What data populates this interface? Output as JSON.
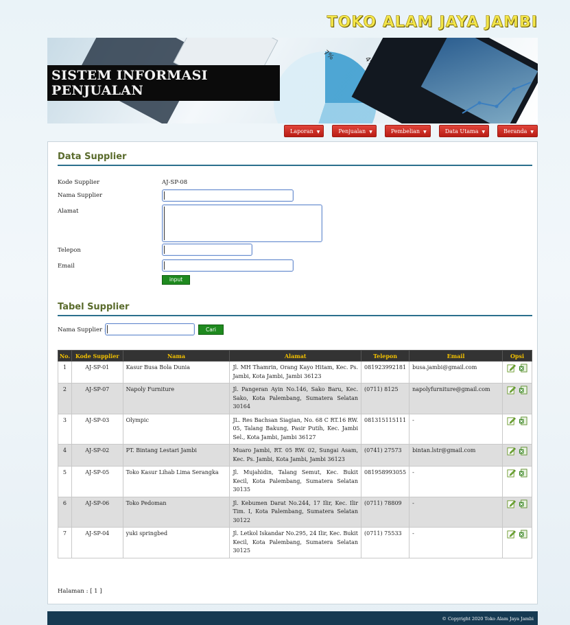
{
  "brand": "TOKO ALAM JAYA JAMBI",
  "banner": {
    "title": "SISTEM INFORMASI PENJUALAN",
    "pct1": "7%",
    "pct2": "4%"
  },
  "nav": [
    {
      "label": "Laporan"
    },
    {
      "label": "Penjualan"
    },
    {
      "label": "Pembelian"
    },
    {
      "label": "Data Utama"
    },
    {
      "label": "Beranda"
    }
  ],
  "form": {
    "title": "Data Supplier",
    "kode_label": "Kode Supplier",
    "kode_value": "AJ-SP-08",
    "nama_label": "Nama Supplier",
    "nama_value": "",
    "alamat_label": "Alamat",
    "alamat_value": "",
    "telepon_label": "Telepon",
    "telepon_value": "",
    "email_label": "Email",
    "email_value": "",
    "submit_label": "input"
  },
  "table_section": {
    "title": "Tabel Supplier",
    "search_label": "Nama Supplier :",
    "search_value": "",
    "search_button": "Cari"
  },
  "table": {
    "headers": [
      "No.",
      "Kode Supplier",
      "Nama",
      "Alamat",
      "Telepon",
      "Email",
      "Opsi"
    ],
    "rows": [
      {
        "no": "1",
        "kode": "AJ-SP-01",
        "nama": "Kasur Busa Bola Dunia",
        "alamat": "Jl. MH Thamrin, Orang Kayo Hitam, Kec. Ps. Jambi, Kota Jambi, Jambi 36123",
        "telepon": "081923992181",
        "email": "busa.jambi@gmail.com"
      },
      {
        "no": "2",
        "kode": "AJ-SP-07",
        "nama": "Napoly Furniture",
        "alamat": "Jl. Pangeran Ayin No.146, Sako Baru, Kec. Sako, Kota Palembang, Sumatera Selatan 30164",
        "telepon": "(0711) 8125",
        "email": "napolyfurniture@gmail.com"
      },
      {
        "no": "3",
        "kode": "AJ-SP-03",
        "nama": "Olympic",
        "alamat": "JL. Res Bachsan Siagian, No. 68 C RT.16 RW. 05, Talang Bakung, Pasir Putih, Kec. Jambi Sel., Kota Jambi, Jambi 36127",
        "telepon": "081315115111",
        "email": "-"
      },
      {
        "no": "4",
        "kode": "AJ-SP-02",
        "nama": "PT. Bintang Lestari Jambi",
        "alamat": "Muaro Jambi, RT. 05 RW. 02, Sungai Asam, Kec. Ps. Jambi, Kota Jambi, Jambi 36123",
        "telepon": "(0741) 27573",
        "email": "bintan.lstr@gmail.com"
      },
      {
        "no": "5",
        "kode": "AJ-SP-05",
        "nama": "Toko Kasur Lihab Lima Serangka",
        "alamat": "Jl. Mujahidin, Talang Semut, Kec. Bukit Kecil, Kota Palembang, Sumatera Selatan 30135",
        "telepon": "081958993055",
        "email": "-"
      },
      {
        "no": "6",
        "kode": "AJ-SP-06",
        "nama": "Toko Pedoman",
        "alamat": "Jl. Kebumen Darat No.244, 17 Ilir, Kec. Ilir Tim. I, Kota Palembang, Sumatera Selatan 30122",
        "telepon": "(0711) 78809",
        "email": "-"
      },
      {
        "no": "7",
        "kode": "AJ-SP-04",
        "nama": "yuki springbed",
        "alamat": "Jl. Letkol Iskandar No.295, 24 Ilir, Kec. Bukit Kecil, Kota Palembang, Sumatera Selatan 30125",
        "telepon": "(0711) 75533",
        "email": "-"
      }
    ]
  },
  "pager": "Halaman : [ 1 ]",
  "footer": "© Copyright 2020 Toko Alam Jaya Jambi",
  "colors": {
    "nav_red": "#c8281f",
    "header_dark": "#333333",
    "header_text": "#f2c000",
    "section_title": "#5a6b2c",
    "section_rule": "#2a6f8c",
    "button_green": "#1f8a1f",
    "footer_bg": "#163a52"
  },
  "icons": {
    "edit": "edit-icon",
    "delete": "delete-excel-icon"
  }
}
